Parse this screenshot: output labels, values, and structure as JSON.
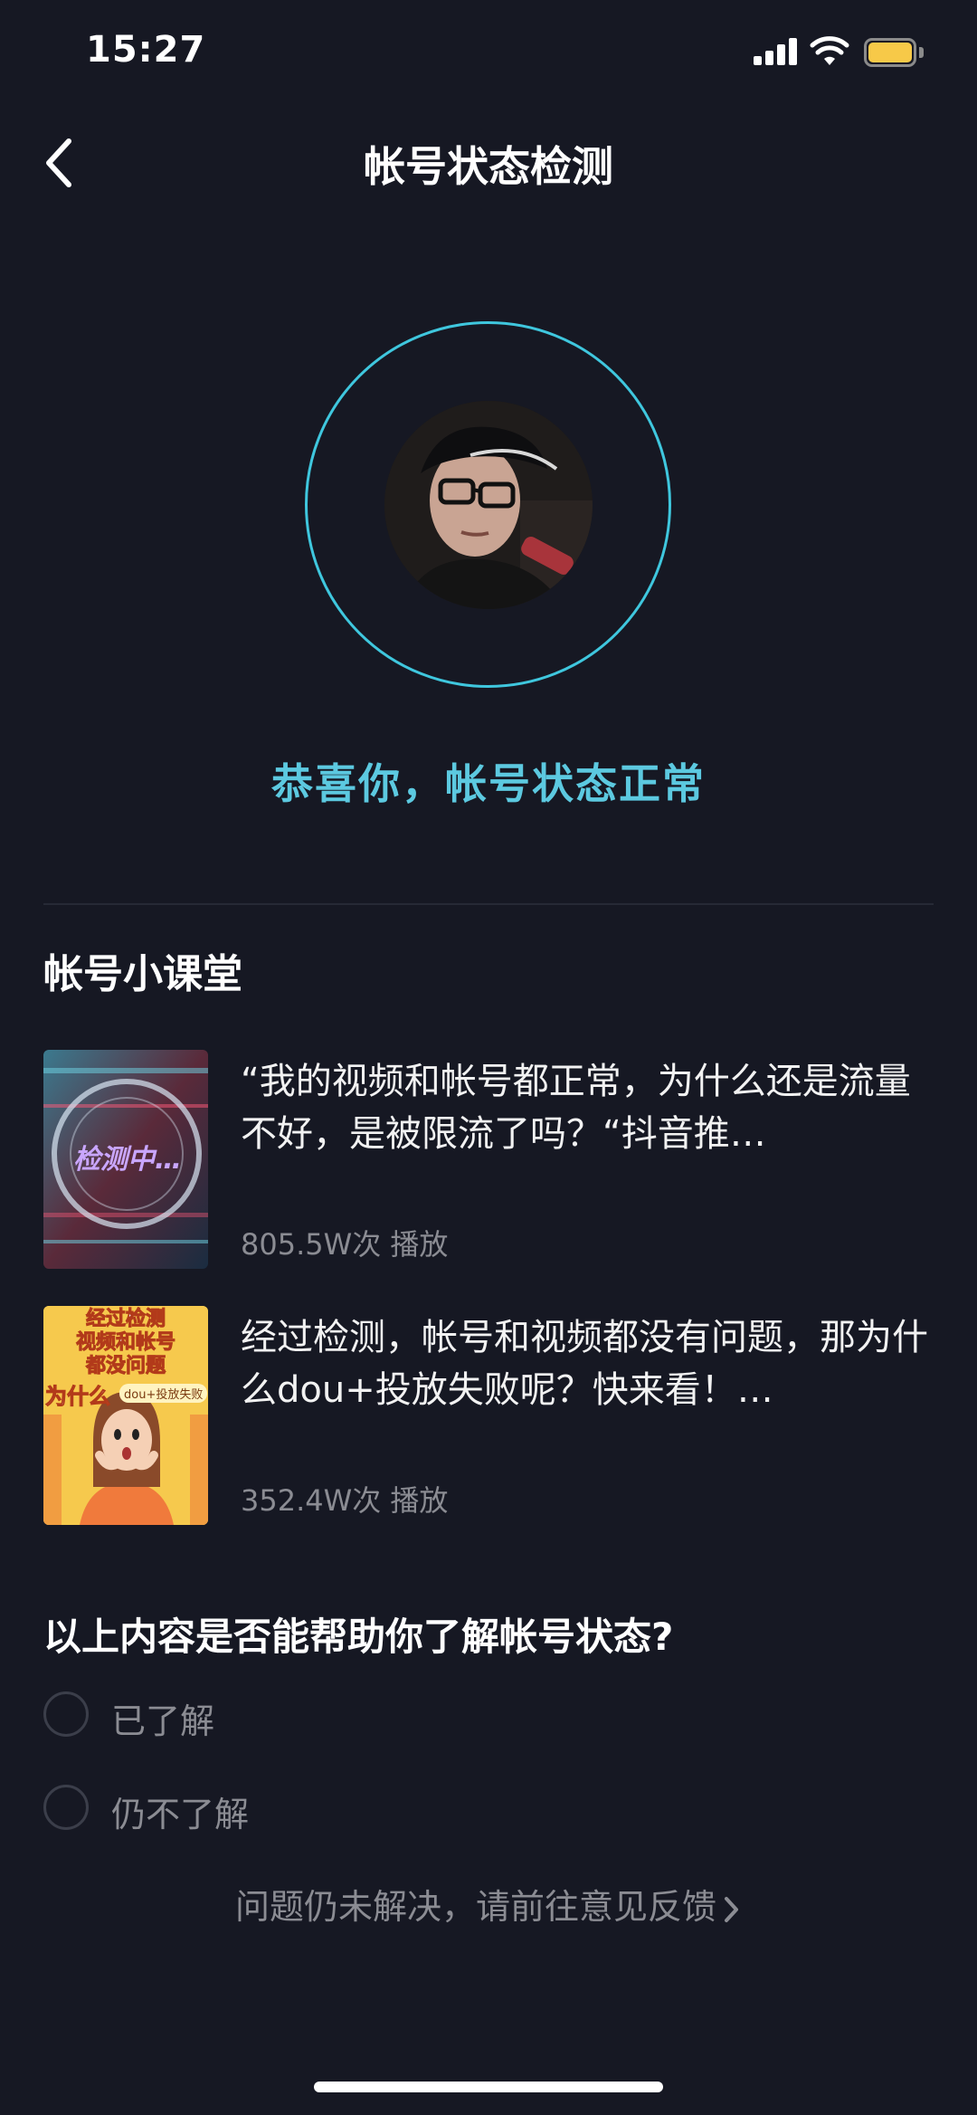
{
  "status_bar": {
    "time": "15:27"
  },
  "nav": {
    "title": "帐号状态检测"
  },
  "result": {
    "message": "恭喜你，帐号状态正常"
  },
  "classroom": {
    "title": "帐号小课堂",
    "items": [
      {
        "text": "“我的视频和帐号都正常，为什么还是流量不好，是被限流了吗？“抖音推…",
        "views": "805.5W次 播放",
        "thumb_label": "检测中…"
      },
      {
        "text": "经过检测，帐号和视频都没有问题，那为什么dou+投放失败呢？快来看！…",
        "views": "352.4W次 播放",
        "thumb_lines": [
          "经过检测",
          "视频和帐号",
          "都没问题"
        ],
        "thumb_why": "为什么",
        "thumb_badge": "dou+投放失败"
      }
    ]
  },
  "survey": {
    "question": "以上内容是否能帮助你了解帐号状态?",
    "options": [
      "已了解",
      "仍不了解"
    ]
  },
  "feedback": {
    "label": "问题仍未解决，请前往意见反馈"
  },
  "colors": {
    "background": "#161823",
    "accent": "#5cc9e0",
    "ring": "#3fc7de",
    "muted": "#8b8c93"
  }
}
